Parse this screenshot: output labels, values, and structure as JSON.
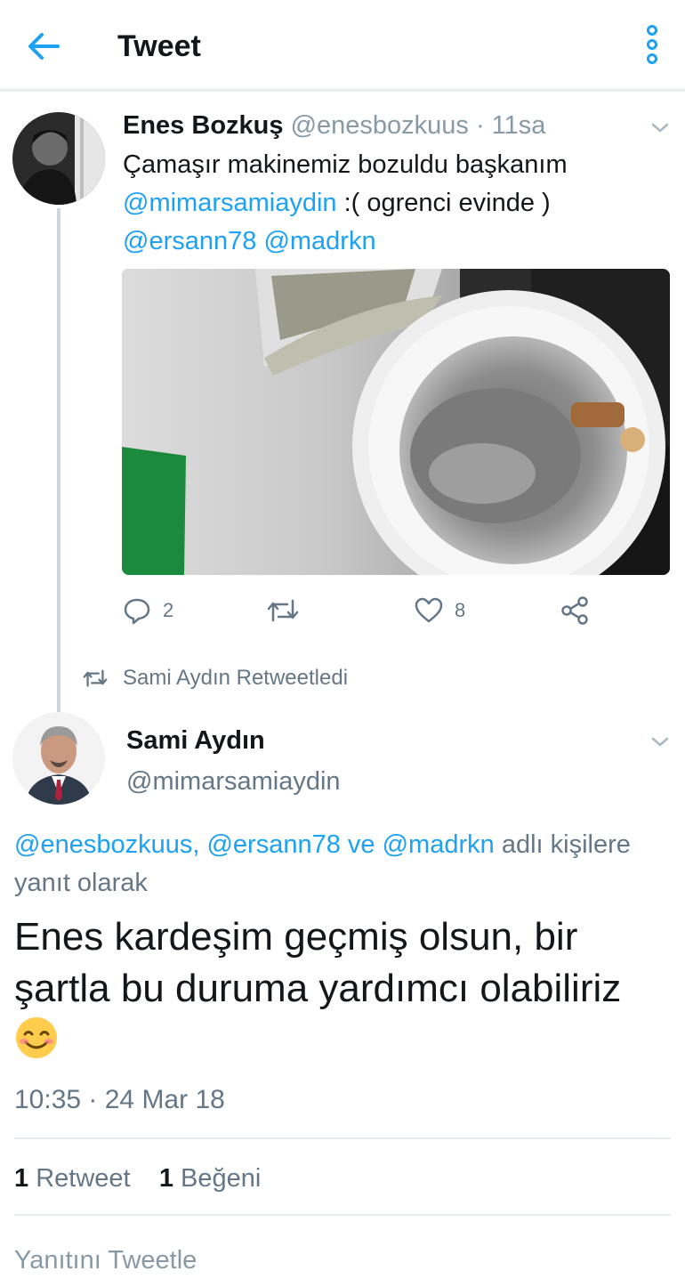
{
  "header": {
    "title": "Tweet",
    "back_icon": "arrow-left-icon",
    "more_icon": "vertical-dots-icon",
    "accent": "#1da1f2"
  },
  "tweet1": {
    "name": "Enes Bozkuş",
    "handle": "@enesbozkuus",
    "time": "· 11sa",
    "text": "Çamaşır makinemiz bozuldu başkanım",
    "mention1": "@mimarsamiaydin",
    "text2": " :( ogrenci evinde )",
    "mention2": "@ersann78",
    "mention3": "@madrkn",
    "actions": {
      "replies": "2",
      "retweets": "",
      "likes": "8"
    }
  },
  "retweet_context": {
    "text": "Sami Aydın Retweetledi"
  },
  "tweet2": {
    "name": "Sami Aydın",
    "handle": "@mimarsamiaydin",
    "reply_mention1": "@enesbozkuus,",
    "reply_mention2": "@ersann78",
    "reply_ve": "ve",
    "reply_mention3": "@madrkn",
    "reply_suffix": "adlı kişilere yanıt olarak",
    "body": "Enes kardeşim geçmiş olsun, bir şartla bu duruma yardımcı olabiliriz",
    "time": "10:35 · 24 Mar 18"
  },
  "stats": {
    "retweet_count": "1",
    "retweet_label": "Retweet",
    "like_count": "1",
    "like_label": "Beğeni"
  },
  "reply_box": {
    "placeholder": "Yanıtını Tweetle"
  }
}
